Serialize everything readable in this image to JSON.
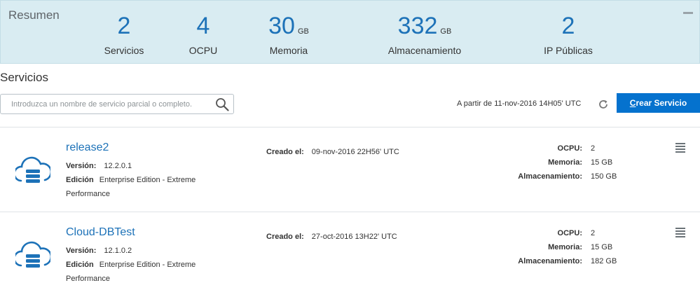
{
  "summary": {
    "title": "Resumen",
    "metrics": [
      {
        "value": "2",
        "unit": "",
        "label": "Servicios"
      },
      {
        "value": "4",
        "unit": "",
        "label": "OCPU"
      },
      {
        "value": "30",
        "unit": "GB",
        "label": "Memoria"
      },
      {
        "value": "332",
        "unit": "GB",
        "label": "Almacenamiento"
      },
      {
        "value": "2",
        "unit": "",
        "label": "IP Públicas"
      }
    ]
  },
  "services": {
    "title": "Servicios",
    "search_placeholder": "Introduzca un nombre de servicio parcial o completo.",
    "timestamp": "A partir de 11-nov-2016 14H05' UTC",
    "create_button": {
      "first": "C",
      "rest": "rear Servicio"
    },
    "labels": {
      "version": "Versión:",
      "edition": "Edición",
      "created": "Creado el:",
      "ocpu": "OCPU:",
      "memory": "Memoria:",
      "storage": "Almacenamiento:"
    },
    "items": [
      {
        "name": "release2",
        "version": "12.2.0.1",
        "edition": "Enterprise Edition - Extreme",
        "edition_cont": "Performance",
        "created": "09-nov-2016 22H56' UTC",
        "ocpu": "2",
        "memory": "15 GB",
        "storage": "150 GB"
      },
      {
        "name": "Cloud-DBTest",
        "version": "12.1.0.2",
        "edition": "Enterprise Edition - Extreme",
        "edition_cont": "Performance",
        "created": "27-oct-2016 13H22' UTC",
        "ocpu": "2",
        "memory": "15 GB",
        "storage": "182 GB"
      }
    ]
  },
  "colors": {
    "summary_bg": "#d9ecf2",
    "accent": "#1d72b8",
    "button": "#0572ce"
  },
  "icons": [
    "collapse-icon",
    "search-icon",
    "refresh-icon",
    "cloud-database-icon",
    "hamburger-menu-icon"
  ]
}
